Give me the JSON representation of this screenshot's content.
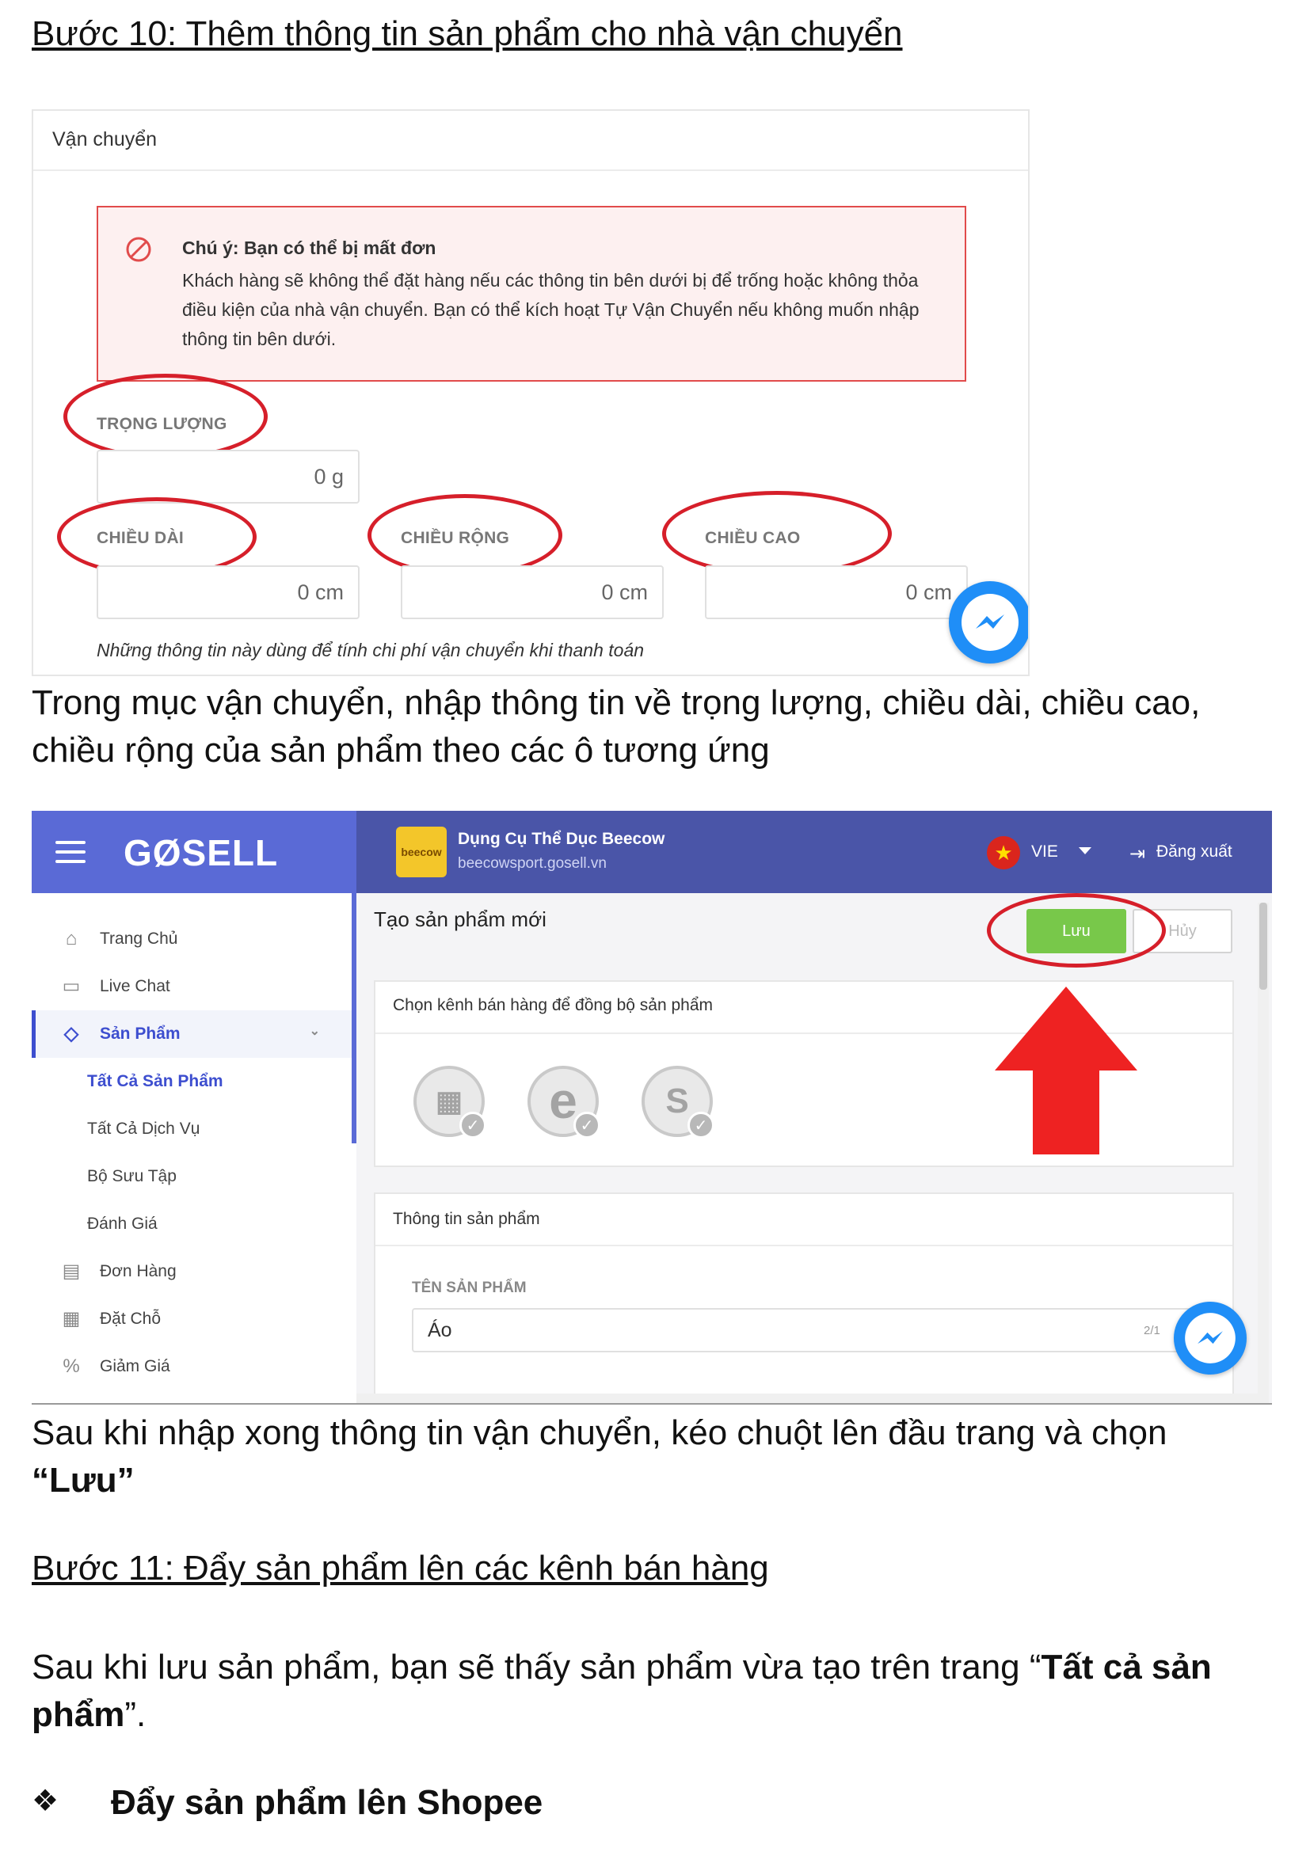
{
  "doc": {
    "step10_heading": "Bước 10: Thêm thông tin sản phẩm cho nhà vận chuyển",
    "caption1": "Trong mục vận chuyển, nhập thông tin về trọng lượng, chiều dài, chiều cao, chiều rộng của sản phẩm theo các ô tương ứng",
    "caption2_prefix": "Sau khi nhập xong thông tin vận chuyển, kéo chuột lên đầu trang và chọn",
    "caption2_bold": "“Lưu”",
    "step11_heading": "Bước 11: Đẩy sản phẩm lên các kênh bán hàng",
    "para3_prefix": "Sau khi lưu sản phẩm, bạn sẽ thấy sản phẩm vừa tạo trên trang “",
    "para3_bold": "Tất cả sản phẩm",
    "para3_suffix": "”.",
    "bullet_symbol": "❖",
    "bullet_text": "Đẩy sản phẩm lên Shopee"
  },
  "shipping": {
    "section_title": "Vận chuyển",
    "warning_title": "Chú ý: Bạn có thể bị mất đơn",
    "warning_body": "Khách hàng sẽ không thể đặt hàng nếu các thông tin bên dưới bị để trống hoặc không thỏa điều kiện của nhà vận chuyển. Bạn có thể kích hoạt Tự Vận Chuyển nếu không muốn nhập thông tin bên dưới.",
    "weight_label": "TRỌNG LƯỢNG",
    "weight_value": "0  g",
    "length_label": "CHIỀU DÀI",
    "length_value": "0  cm",
    "width_label": "CHIỀU RỘNG",
    "width_value": "0  cm",
    "height_label": "CHIỀU CAO",
    "height_value": "0  cm",
    "note": "Những thông tin này dùng để tính chi phí vận chuyển khi thanh toán",
    "annotation_color": "#d61f2a"
  },
  "app": {
    "logo": "GØSELL",
    "shop_logo_text": "beecow",
    "shop_name": "Dụng Cụ Thể Dục Beecow",
    "shop_url": "beecowsport.gosell.vn",
    "flag_star": "★",
    "language": "VIE",
    "logout": "Đăng xuất",
    "logout_icon": "⇥",
    "sidebar": [
      {
        "label": "Trang Chủ",
        "icon": "⌂"
      },
      {
        "label": "Live Chat",
        "icon": "▭"
      },
      {
        "label": "Sản Phẩm",
        "icon": "◇",
        "chevron": "⌄"
      },
      {
        "label": "Tất Cả Sản Phẩm"
      },
      {
        "label": "Tất Cả Dịch Vụ"
      },
      {
        "label": "Bộ Sưu Tập"
      },
      {
        "label": "Đánh Giá"
      },
      {
        "label": "Đơn Hàng",
        "icon": "▤"
      },
      {
        "label": "Đặt Chỗ",
        "icon": "▦"
      },
      {
        "label": "Giảm Giá",
        "icon": "%"
      }
    ],
    "page_title": "Tạo sản phẩm mới",
    "save_label": "Lưu",
    "cancel_label": "Hủy",
    "channels_title": "Chọn kênh bán hàng để đồng bộ sản phẩm",
    "channel_icons": [
      "▦",
      "e",
      "S"
    ],
    "channel_check": "✓",
    "product_info_title": "Thông tin sản phẩm",
    "product_name_label": "TÊN SẢN PHẨM",
    "product_name_value": "Áo",
    "product_name_counter": "2/1",
    "brand_color": "#5a6ad6",
    "save_color": "#78c84a",
    "arrow_color": "#ee2222"
  }
}
